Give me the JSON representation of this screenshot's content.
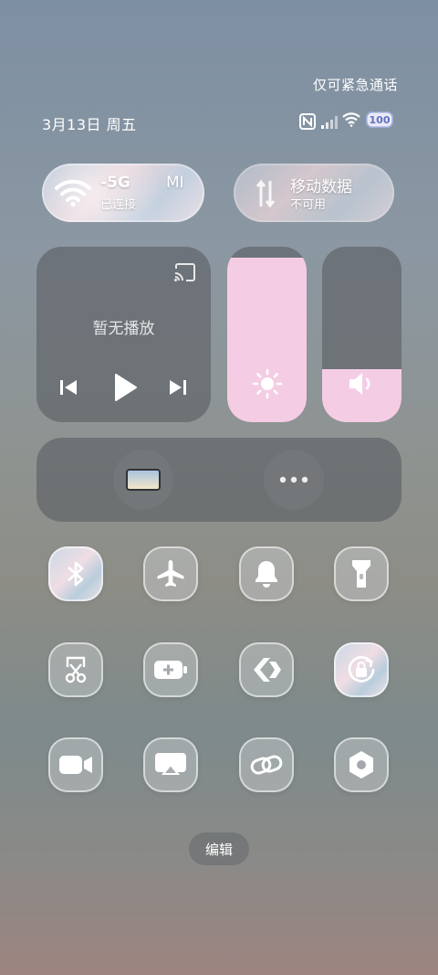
{
  "status": {
    "emergency_text": "仅可紧急通话",
    "date_text": "3月13日 周五",
    "battery_level": "100",
    "icons": [
      "nfc-icon",
      "signal-icon",
      "wifi-icon",
      "battery-icon"
    ]
  },
  "wifi_pill": {
    "name": "-5G",
    "name_suffix": "MI",
    "status": "已连接",
    "icon": "wifi-icon",
    "active": true
  },
  "mobile_pill": {
    "name": "移动数据",
    "status": "不可用",
    "icon": "mobile-data-icon",
    "active": false
  },
  "media": {
    "status": "暂无播放",
    "icons": [
      "cast-icon",
      "previous-icon",
      "play-icon",
      "next-icon"
    ]
  },
  "brightness": {
    "level_percent": 94,
    "icon": "sun-icon"
  },
  "volume": {
    "level_percent": 30,
    "icon": "speaker-icon"
  },
  "shortcuts": {
    "icons": [
      "screen-card-icon",
      "more-icon"
    ]
  },
  "toggles": [
    {
      "icon": "bluetooth-icon",
      "on": true
    },
    {
      "icon": "airplane-icon",
      "on": false
    },
    {
      "icon": "bell-icon",
      "on": false
    },
    {
      "icon": "flashlight-icon",
      "on": false
    },
    {
      "icon": "screenshot-scissors-icon",
      "on": false
    },
    {
      "icon": "battery-saver-icon",
      "on": false
    },
    {
      "icon": "code-arrows-icon",
      "on": false
    },
    {
      "icon": "rotation-lock-icon",
      "on": true
    },
    {
      "icon": "video-camera-icon",
      "on": false
    },
    {
      "icon": "screen-cast-icon",
      "on": false
    },
    {
      "icon": "link-icon",
      "on": false
    },
    {
      "icon": "settings-hex-icon",
      "on": false
    }
  ],
  "edit_label": "编辑",
  "colors": {
    "accent_pink": "#f4cde4",
    "panel_gray": "#5a5e62"
  }
}
